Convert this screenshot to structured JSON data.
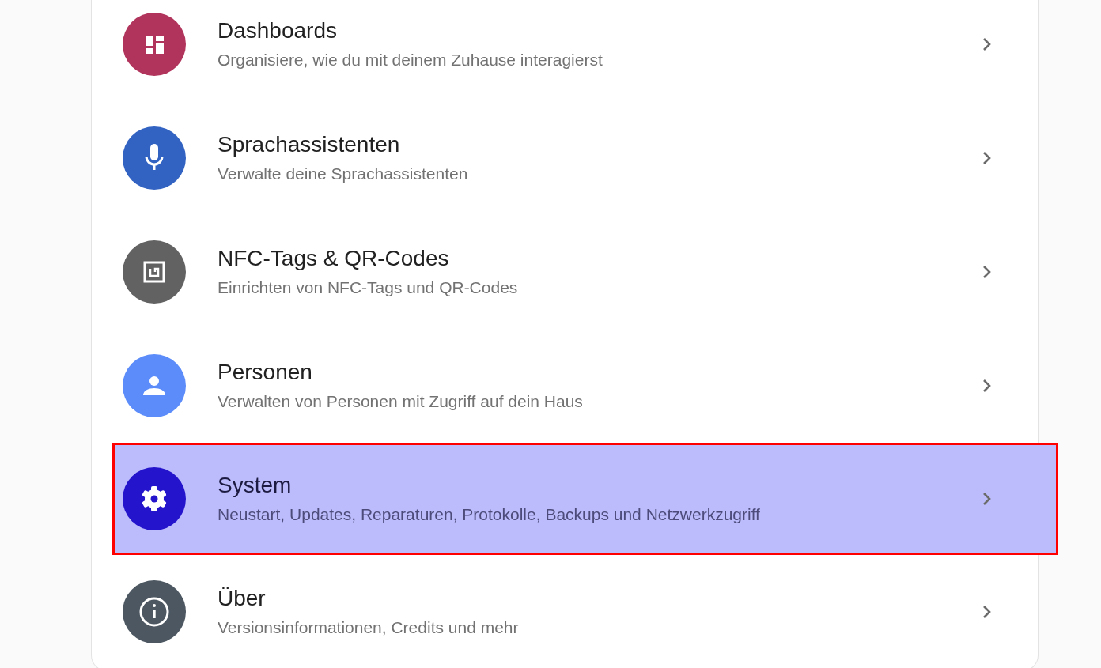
{
  "items": [
    {
      "kind": "dashboard",
      "color": "#b1345c",
      "title": "Dashboards",
      "subtitle": "Organisiere, wie du mit deinem Zuhause interagierst",
      "selected": false
    },
    {
      "kind": "microphone",
      "color": "#3263c2",
      "title": "Sprachassistenten",
      "subtitle": "Verwalte deine Sprachassistenten",
      "selected": false
    },
    {
      "kind": "nfc",
      "color": "#626262",
      "title": "NFC-Tags & QR-Codes",
      "subtitle": "Einrichten von NFC-Tags und QR-Codes",
      "selected": false
    },
    {
      "kind": "person",
      "color": "#5b8cfa",
      "title": "Personen",
      "subtitle": "Verwalten von Personen mit Zugriff auf dein Haus",
      "selected": false
    },
    {
      "kind": "gear",
      "color": "#2414cc",
      "title": "System",
      "subtitle": "Neustart, Updates, Reparaturen, Protokolle, Backups und Netzwerkzugriff",
      "selected": true
    },
    {
      "kind": "info",
      "color": "#4c5761",
      "title": "Über",
      "subtitle": "Versionsinformationen, Credits und mehr",
      "selected": false
    }
  ]
}
